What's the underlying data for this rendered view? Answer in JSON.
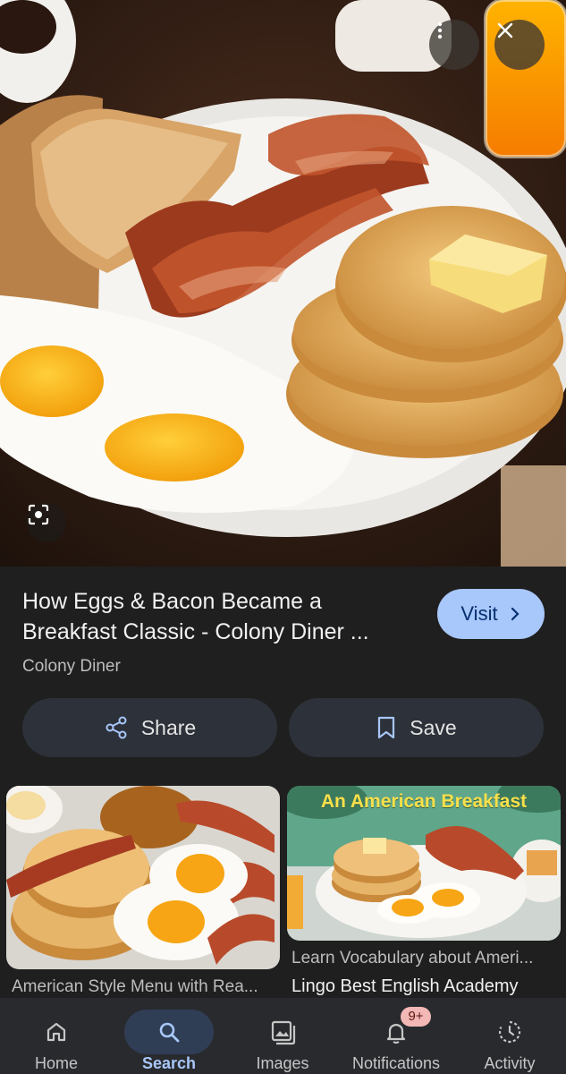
{
  "hero": {
    "more_icon": "more-vert-icon",
    "close_icon": "close-icon",
    "lens_icon": "lens-icon"
  },
  "result": {
    "title": "How Eggs & Bacon Became a Breakfast Classic - Colony Diner ...",
    "source": "Colony Diner",
    "visit_label": "Visit",
    "share_label": "Share",
    "save_label": "Save"
  },
  "related": [
    {
      "caption": "American Style Menu with Rea...",
      "source": ""
    },
    {
      "banner": "An American Breakfast",
      "caption": "Learn Vocabulary about Ameri...",
      "source": "Lingo Best English Academy"
    }
  ],
  "nav": {
    "items": [
      {
        "label": "Home",
        "icon": "home-icon"
      },
      {
        "label": "Search",
        "icon": "search-icon"
      },
      {
        "label": "Images",
        "icon": "images-icon"
      },
      {
        "label": "Notifications",
        "icon": "bell-icon",
        "badge": "9+"
      },
      {
        "label": "Activity",
        "icon": "activity-icon"
      }
    ],
    "active": "Search"
  },
  "colors": {
    "accent": "#a8c7fa",
    "background": "#1f1f1f",
    "badge": "#f2b8b5"
  }
}
